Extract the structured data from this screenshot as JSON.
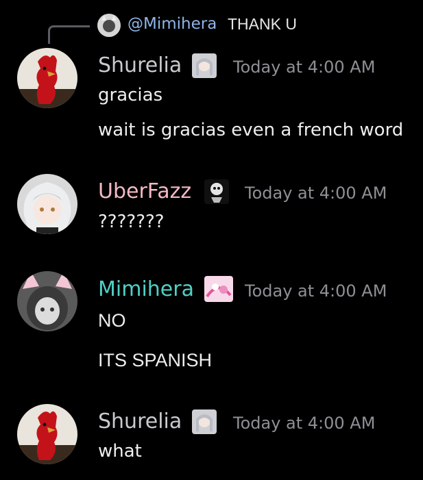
{
  "reply": {
    "mention": "@Mimihera",
    "text": "THANK U"
  },
  "messages": [
    {
      "author": "Shurelia",
      "author_color": "#c9cacf",
      "badge_icon": "anime-girl-badge-icon",
      "timestamp": "Today at 4:00 AM",
      "lines": [
        "gracias",
        "wait is gracias even a french word"
      ]
    },
    {
      "author": "UberFazz",
      "author_color": "#f4b9c3",
      "badge_icon": "monochrome-character-badge-icon",
      "timestamp": "Today at 4:00 AM",
      "lines": [
        "???????"
      ]
    },
    {
      "author": "Mimihera",
      "author_color": "#4fd1c5",
      "badge_icon": "pink-character-badge-icon",
      "timestamp": "Today at 4:00 AM",
      "lines": [
        "NO",
        "ITS SPANISH"
      ]
    },
    {
      "author": "Shurelia",
      "author_color": "#c9cacf",
      "badge_icon": "anime-girl-badge-icon",
      "timestamp": "Today at 4:00 AM",
      "lines": [
        "what"
      ]
    }
  ]
}
